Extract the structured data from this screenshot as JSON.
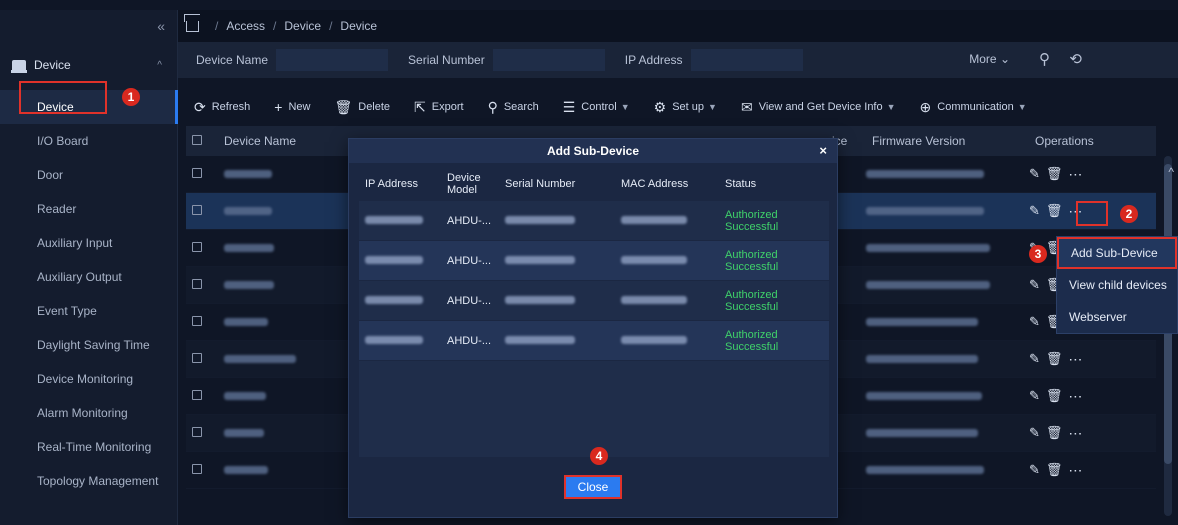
{
  "sidebar": {
    "collapse_icon": "double-chevron-left-icon",
    "group_label": "Device",
    "items": [
      {
        "label": "Device",
        "active": true
      },
      {
        "label": "I/O Board"
      },
      {
        "label": "Door"
      },
      {
        "label": "Reader"
      },
      {
        "label": "Auxiliary Input"
      },
      {
        "label": "Auxiliary Output"
      },
      {
        "label": "Event Type"
      },
      {
        "label": "Daylight Saving Time"
      },
      {
        "label": "Device Monitoring"
      },
      {
        "label": "Alarm Monitoring"
      },
      {
        "label": "Real-Time Monitoring"
      },
      {
        "label": "Topology Management"
      }
    ]
  },
  "breadcrumb": [
    "Access",
    "Device",
    "Device"
  ],
  "filter": {
    "device_name_label": "Device Name",
    "serial_number_label": "Serial Number",
    "ip_address_label": "IP Address",
    "more_label": "More"
  },
  "toolbar": {
    "refresh": "Refresh",
    "new": "New",
    "delete": "Delete",
    "export": "Export",
    "search": "Search",
    "control": "Control",
    "setup": "Set up",
    "view_info": "View and Get Device Info",
    "communication": "Communication"
  },
  "table": {
    "headers": {
      "device_name": "Device Name",
      "firmware": "Firmware Version",
      "operations": "Operations",
      "partial": "vice"
    }
  },
  "context_menu": [
    "Add Sub-Device",
    "View child devices",
    "Webserver"
  ],
  "modal": {
    "title": "Add Sub-Device",
    "headers": [
      "IP Address",
      "Device Model",
      "Serial Number",
      "MAC Address",
      "Status"
    ],
    "rows": [
      {
        "model": "AHDU-...",
        "status": "Authorized Successful"
      },
      {
        "model": "AHDU-...",
        "status": "Authorized Successful"
      },
      {
        "model": "AHDU-...",
        "status": "Authorized Successful"
      },
      {
        "model": "AHDU-...",
        "status": "Authorized Successful"
      }
    ],
    "close_label": "Close"
  },
  "markers": [
    "1",
    "2",
    "3",
    "4"
  ],
  "colors": {
    "accent": "#2b7bf0",
    "highlight": "#e0322a",
    "success": "#3fd26a"
  }
}
